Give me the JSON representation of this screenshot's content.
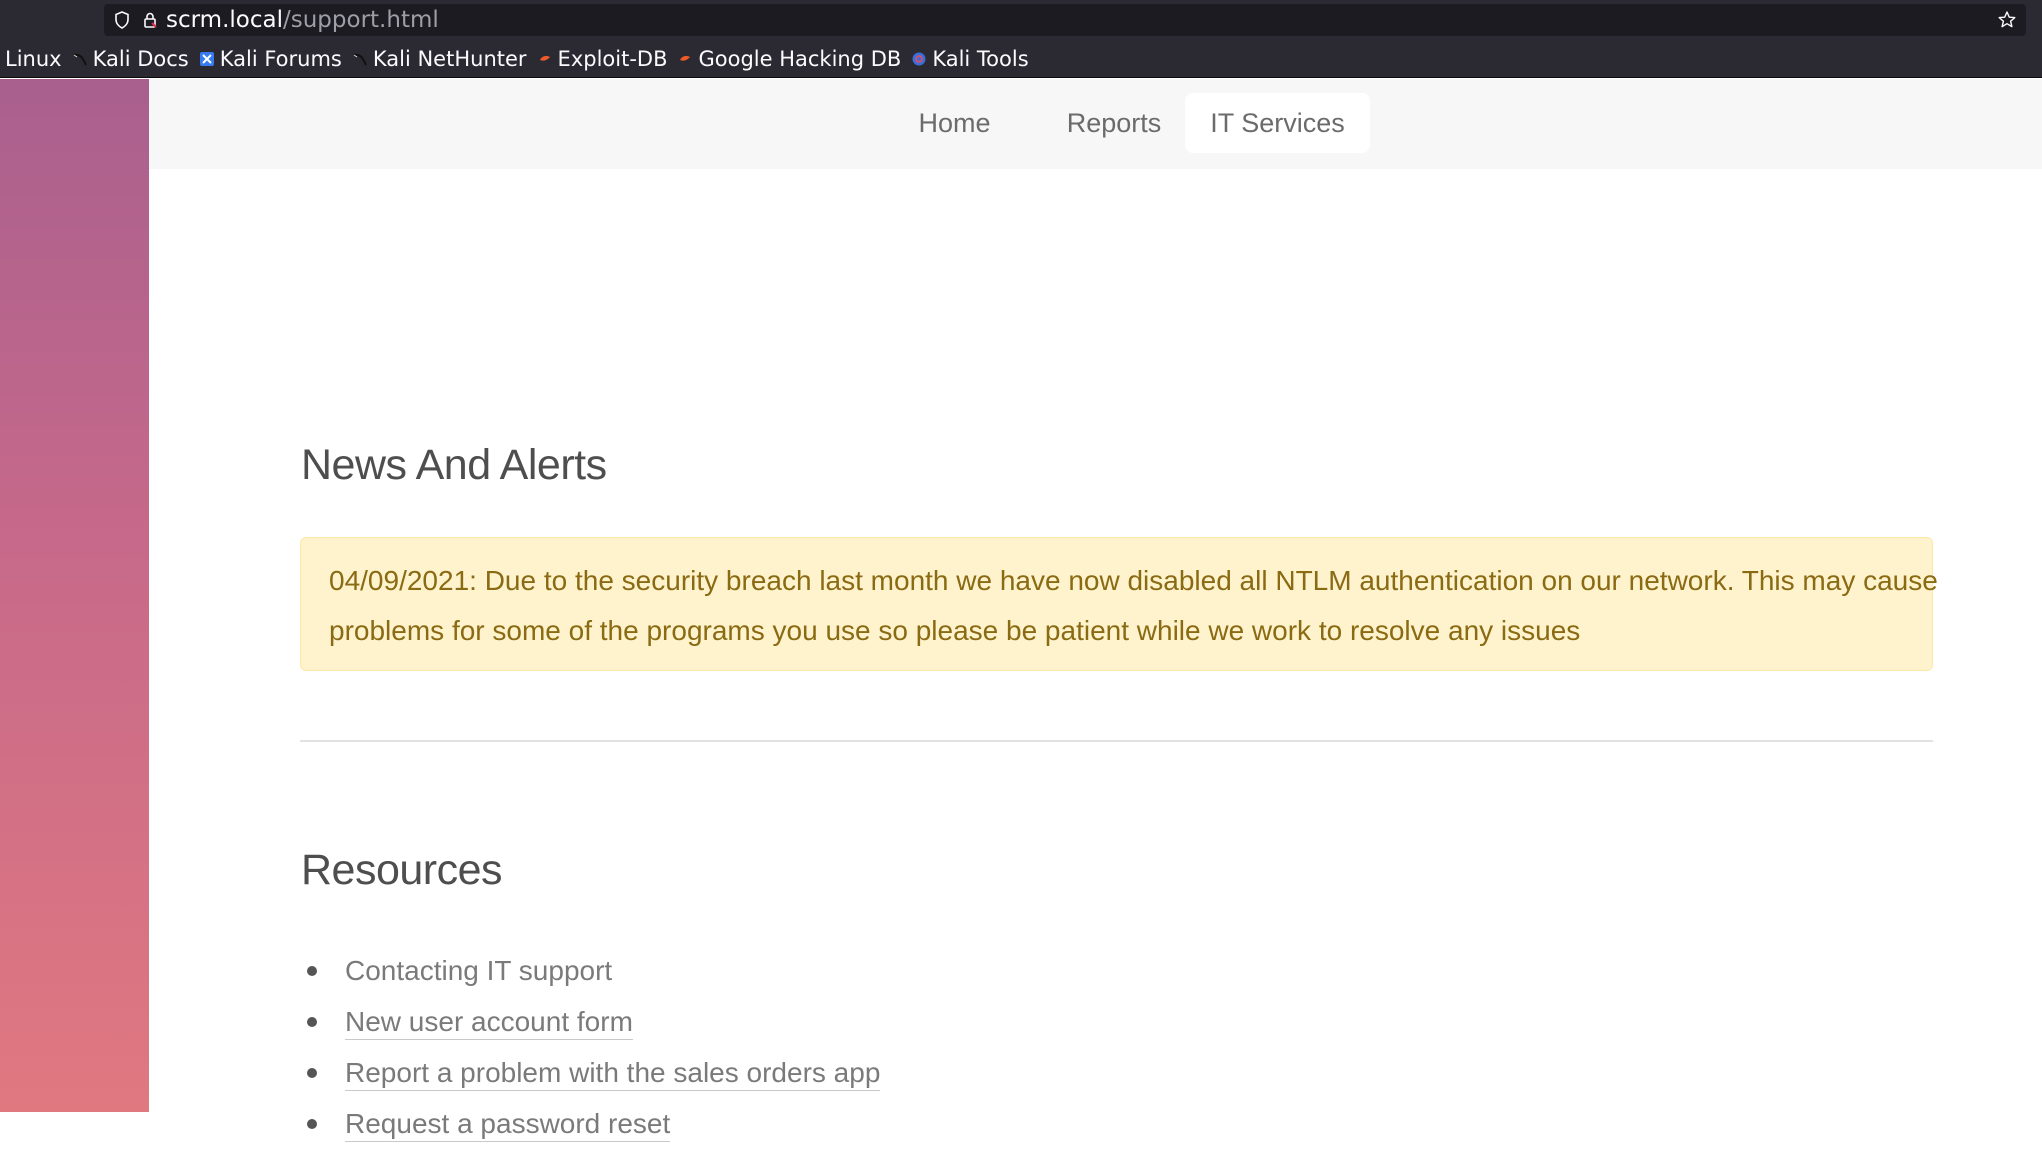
{
  "browser": {
    "url_host": "scrm.local",
    "url_path": "/support.html",
    "bookmarks": [
      {
        "label": "Linux",
        "icon": "none"
      },
      {
        "label": "Kali Docs",
        "icon": "kali-dragon-icon"
      },
      {
        "label": "Kali Forums",
        "icon": "kali-forums-icon"
      },
      {
        "label": "Kali NetHunter",
        "icon": "kali-dragon-icon"
      },
      {
        "label": "Exploit-DB",
        "icon": "exploit-db-icon"
      },
      {
        "label": "Google Hacking DB",
        "icon": "exploit-db-icon"
      },
      {
        "label": "Kali Tools",
        "icon": "kali-tools-icon"
      }
    ]
  },
  "nav": {
    "items": [
      {
        "label": "Home",
        "active": false
      },
      {
        "label": "Reports",
        "active": false
      },
      {
        "label": "IT Services",
        "active": true
      }
    ]
  },
  "news": {
    "heading": "News And Alerts",
    "alert_line1": "04/09/2021: Due to the security breach last month we have now disabled all NTLM authentication on our network. This may cause",
    "alert_line2": "problems for some of the programs you use so please be patient while we work to resolve any issues"
  },
  "resources": {
    "heading": "Resources",
    "items": [
      {
        "label": "Contacting IT support",
        "link": false
      },
      {
        "label": "New user account form",
        "link": true
      },
      {
        "label": "Report a problem with the sales orders app",
        "link": true
      },
      {
        "label": "Request a password reset",
        "link": true
      }
    ]
  },
  "colors": {
    "chrome_bg": "#2b2a33",
    "urlbar_bg": "#1c1b22",
    "alert_bg": "#fef3cd",
    "alert_text": "#8a6a12",
    "sidebar_gradient_top": "#a9608e",
    "sidebar_gradient_bottom": "#e07880"
  }
}
